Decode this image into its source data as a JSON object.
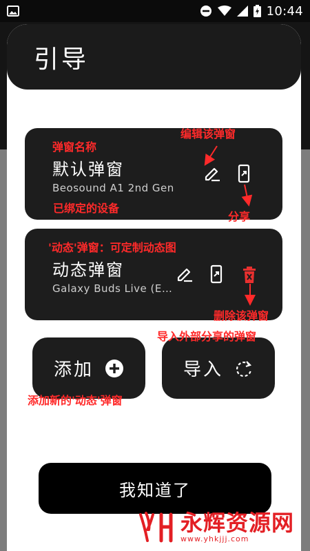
{
  "status_bar": {
    "time": "10:44",
    "icons": [
      "image-icon",
      "do-not-disturb-icon",
      "wifi-icon",
      "signal-icon",
      "battery-charging-icon"
    ]
  },
  "dialog": {
    "title": "引导",
    "confirm_label": "我知道了"
  },
  "cards": [
    {
      "name": "默认弹窗",
      "device": "Beosound A1 2nd Gen",
      "icons": [
        "edit-icon",
        "share-icon"
      ]
    },
    {
      "name": "动态弹窗",
      "device": "Galaxy Buds Live (E…",
      "icons": [
        "edit-icon",
        "share-icon",
        "delete-icon"
      ]
    }
  ],
  "actions": {
    "add_label": "添加",
    "import_label": "导入"
  },
  "annotations": {
    "popup_name": "弹窗名称",
    "edit_popup": "编辑该弹窗",
    "bound_device": "已绑定的设备",
    "share": "分享",
    "dynamic_popup": "'动态'弹窗：可定制动态图",
    "delete_popup": "删除该弹窗",
    "import_external": "导入外部分享的弹窗",
    "add_new_dynamic": "添加新的'动态'弹窗"
  },
  "watermark": {
    "brand": "永辉资源网",
    "url": "www.yhkjjj.com"
  },
  "colors": {
    "annotation": "#ff2a2a",
    "card_bg": "#1d1d1d",
    "delete_icon": "#e8302f",
    "watermark": "#e31f24"
  }
}
